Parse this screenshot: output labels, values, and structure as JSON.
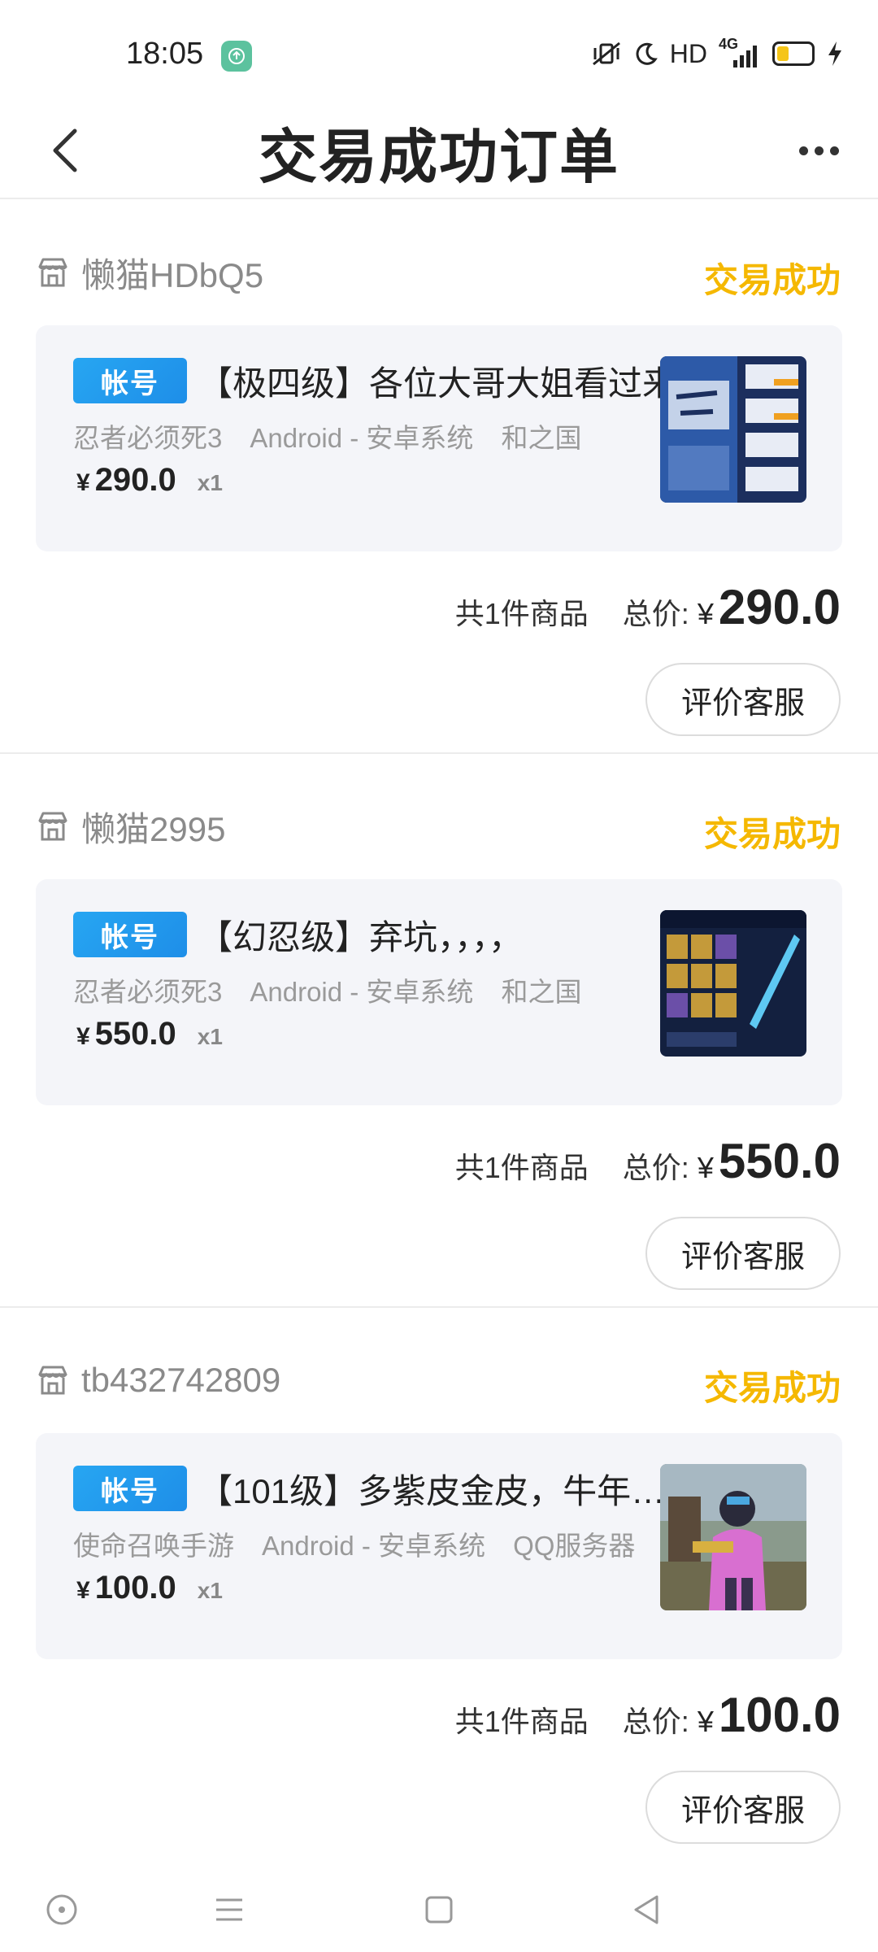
{
  "status_bar": {
    "time": "18:05",
    "hd": "HD",
    "network": "4G",
    "battery_level": 0.35
  },
  "header": {
    "title": "交易成功订单"
  },
  "orders": [
    {
      "seller": "懒猫HDbQ5",
      "status": "交易成功",
      "tag": "帐号",
      "title": "【极四级】各位大哥大姐看过来",
      "game": "忍者必须死3",
      "platform": "Android - 安卓系统",
      "server": "和之国",
      "price_yen": "¥",
      "price": "290.0",
      "qty": "x1",
      "count_text": "共1件商品",
      "total_label": "总价:",
      "total_yen": "¥",
      "total": "290.0",
      "button": "评价客服"
    },
    {
      "seller": "懒猫2995",
      "status": "交易成功",
      "tag": "帐号",
      "title": "【幻忍级】弃坑，，，，",
      "game": "忍者必须死3",
      "platform": "Android - 安卓系统",
      "server": "和之国",
      "price_yen": "¥",
      "price": "550.0",
      "qty": "x1",
      "count_text": "共1件商品",
      "total_label": "总价:",
      "total_yen": "¥",
      "total": "550.0",
      "button": "评价客服"
    },
    {
      "seller": "tb432742809",
      "status": "交易成功",
      "tag": "帐号",
      "title": "【101级】多紫皮金皮，牛年…",
      "game": "使命召唤手游",
      "platform": "Android - 安卓系统",
      "server": "QQ服务器",
      "price_yen": "¥",
      "price": "100.0",
      "qty": "x1",
      "count_text": "共1件商品",
      "total_label": "总价:",
      "total_yen": "¥",
      "total": "100.0",
      "button": "评价客服"
    }
  ],
  "colors": {
    "status_success": "#f5b800",
    "tag_blue": "#1e8ee8",
    "card_bg": "#f4f5f9"
  },
  "icons": {
    "back": "chevron-left-icon",
    "more": "more-dots-icon",
    "store": "store-icon"
  }
}
